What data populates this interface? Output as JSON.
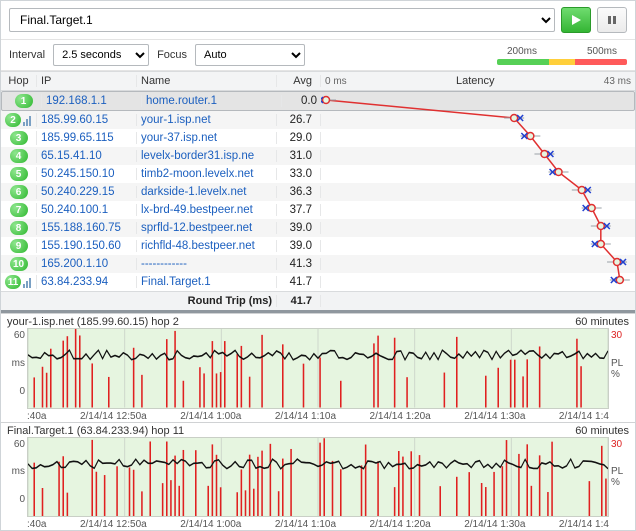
{
  "target_select": {
    "value": "Final.Target.1"
  },
  "buttons": {
    "play": "play",
    "pause": "pause"
  },
  "options": {
    "interval_label": "Interval",
    "interval_value": "2.5 seconds",
    "focus_label": "Focus",
    "focus_value": "Auto"
  },
  "scale": {
    "low": "200ms",
    "high": "500ms"
  },
  "columns": {
    "hop": "Hop",
    "ip": "IP",
    "name": "Name",
    "avg": "Avg",
    "latency": "Latency"
  },
  "latency_axis": {
    "min_label": "0 ms",
    "max_label": "43 ms",
    "min": 0,
    "max": 43
  },
  "summary": {
    "label": "Round Trip (ms)",
    "value": "41.7"
  },
  "hops": [
    {
      "n": 1,
      "ip": "192.168.1.1",
      "name": "home.router.1",
      "avg": 0.0,
      "selected": true,
      "bars": false
    },
    {
      "n": 2,
      "ip": "185.99.60.15",
      "name": "your-1.isp.net",
      "avg": 26.7,
      "bars": true
    },
    {
      "n": 3,
      "ip": "185.99.65.115",
      "name": "your-37.isp.net",
      "avg": 29.0
    },
    {
      "n": 4,
      "ip": "65.15.41.10",
      "name": "levelx-border31.isp.ne",
      "avg": 31.0
    },
    {
      "n": 5,
      "ip": "50.245.150.10",
      "name": "timb2-moon.levelx.net",
      "avg": 33.0
    },
    {
      "n": 6,
      "ip": "50.240.229.15",
      "name": "darkside-1.levelx.net",
      "avg": 36.3
    },
    {
      "n": 7,
      "ip": "50.240.100.1",
      "name": "lx-brd-49.bestpeer.net",
      "avg": 37.7
    },
    {
      "n": 8,
      "ip": "155.188.160.75",
      "name": "sprfld-12.bestpeer.net",
      "avg": 39.0
    },
    {
      "n": 9,
      "ip": "155.190.150.60",
      "name": "richfld-48.bestpeer.net",
      "avg": 39.0
    },
    {
      "n": 10,
      "ip": "165.200.1.10",
      "name": "------------",
      "avg": 41.3
    },
    {
      "n": 11,
      "ip": "63.84.233.94",
      "name": "Final.Target.1",
      "avg": 41.7,
      "bars": true
    }
  ],
  "chart_data": {
    "type": "line",
    "title": "Latency",
    "xlabel": "Hop",
    "ylabel": "ms",
    "ylim": [
      0,
      43
    ],
    "categories": [
      1,
      2,
      3,
      4,
      5,
      6,
      7,
      8,
      9,
      10,
      11
    ],
    "series": [
      {
        "name": "avg",
        "values": [
          0.0,
          26.7,
          29.0,
          31.0,
          33.0,
          36.3,
          37.7,
          39.0,
          39.0,
          41.3,
          41.7
        ]
      }
    ]
  },
  "timelines": [
    {
      "title": "your-1.isp.net (185.99.60.15) hop 2",
      "duration": "60 minutes",
      "y_max": 60,
      "y_unit": "ms",
      "pl_max": 30,
      "pl_unit": "PL %",
      "x_ticks": [
        ":40a",
        "2/14/14 12:50a",
        "2/14/14 1:00a",
        "2/14/14 1:10a",
        "2/14/14 1:20a",
        "2/14/14 1:30a",
        "2/14/14 1:4"
      ]
    },
    {
      "title": "Final.Target.1 (63.84.233.94) hop 11",
      "duration": "60 minutes",
      "y_max": 60,
      "y_unit": "ms",
      "pl_max": 30,
      "pl_unit": "PL %",
      "x_ticks": [
        ":40a",
        "2/14/14 12:50a",
        "2/14/14 1:00a",
        "2/14/14 1:10a",
        "2/14/14 1:20a",
        "2/14/14 1:30a",
        "2/14/14 1:4"
      ]
    }
  ]
}
